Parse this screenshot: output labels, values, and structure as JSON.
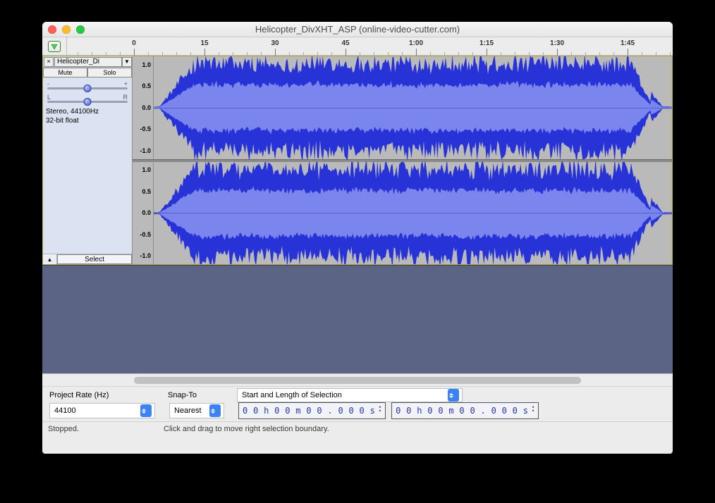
{
  "window": {
    "title": "Helicopter_DivXHT_ASP (online-video-cutter.com)"
  },
  "ruler": {
    "labels": [
      "0",
      "15",
      "30",
      "45",
      "1:00",
      "1:15",
      "1:30",
      "1:45"
    ]
  },
  "track": {
    "name": "Helicopter_Di",
    "mute": "Mute",
    "solo": "Solo",
    "gain": {
      "left_label": "-",
      "right_label": "+"
    },
    "pan": {
      "left_label": "L",
      "right_label": "R"
    },
    "info_line1": "Stereo, 44100Hz",
    "info_line2": "32-bit float",
    "select": "Select",
    "vruler_labels": [
      "1.0",
      "0.5",
      "0.0",
      "-0.5",
      "-1.0"
    ]
  },
  "bottom": {
    "project_rate_label": "Project Rate (Hz)",
    "project_rate_value": "44100",
    "snap_label": "Snap-To",
    "snap_value": "Nearest",
    "selection_mode": "Start and Length of Selection",
    "time1": "0 0 h 0 0 m 0 0 . 0 0 0 s",
    "time2": "0 0 h 0 0 m 0 0 . 0 0 0 s"
  },
  "status": {
    "state": "Stopped.",
    "hint": "Click and drag to move right selection boundary."
  }
}
